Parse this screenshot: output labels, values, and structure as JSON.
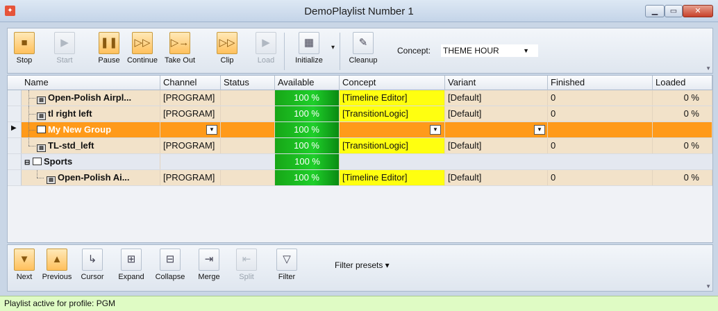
{
  "window": {
    "title": "DemoPlaylist Number 1",
    "app_icon": "app-logo-icon"
  },
  "top_toolbar": {
    "buttons": [
      {
        "label": "Stop",
        "icon": "stop-icon",
        "enabled": true
      },
      {
        "label": "Start",
        "icon": "play-icon",
        "enabled": false
      },
      {
        "label": "Pause",
        "icon": "pause-icon",
        "enabled": true
      },
      {
        "label": "Continue",
        "icon": "continue-icon",
        "enabled": true
      },
      {
        "label": "Take Out",
        "icon": "take-out-icon",
        "enabled": true
      },
      {
        "label": "Clip",
        "icon": "clip-icon",
        "enabled": true
      },
      {
        "label": "Load",
        "icon": "load-icon",
        "enabled": false
      },
      {
        "label": "Initialize",
        "icon": "initialize-icon",
        "enabled": true
      },
      {
        "label": "Cleanup",
        "icon": "cleanup-icon",
        "enabled": true
      }
    ],
    "concept_label": "Concept:",
    "concept_value": "THEME HOUR"
  },
  "grid": {
    "columns": [
      "Name",
      "Channel",
      "Status",
      "Available",
      "Concept",
      "Variant",
      "Finished",
      "Loaded"
    ],
    "rows": [
      {
        "name": "Open-Polish Airpl...",
        "channel": "[PROGRAM]",
        "status": "",
        "available": "100 %",
        "concept": "[Timeline Editor]",
        "variant": "[Default]",
        "finished": "0",
        "loaded": "0 %"
      },
      {
        "name": "tl right left",
        "channel": "[PROGRAM]",
        "status": "",
        "available": "100 %",
        "concept": "[TransitionLogic]",
        "variant": "[Default]",
        "finished": "0",
        "loaded": "0 %"
      },
      {
        "name": "My New Group",
        "channel": "",
        "status": "",
        "available": "100 %",
        "concept": "",
        "variant": "",
        "finished": "",
        "loaded": ""
      },
      {
        "name": "TL-std_left",
        "channel": "[PROGRAM]",
        "status": "",
        "available": "100 %",
        "concept": "[TransitionLogic]",
        "variant": "[Default]",
        "finished": "0",
        "loaded": "0 %"
      },
      {
        "name": "Sports",
        "channel": "",
        "status": "",
        "available": "100 %",
        "concept": "",
        "variant": "",
        "finished": "",
        "loaded": ""
      },
      {
        "name": "Open-Polish Ai...",
        "channel": "[PROGRAM]",
        "status": "",
        "available": "100 %",
        "concept": "[Timeline Editor]",
        "variant": "[Default]",
        "finished": "0",
        "loaded": "0 %"
      }
    ]
  },
  "bottom_toolbar": {
    "buttons": [
      {
        "label": "Next",
        "icon": "next-icon",
        "enabled": true
      },
      {
        "label": "Previous",
        "icon": "previous-icon",
        "enabled": true
      },
      {
        "label": "Cursor",
        "icon": "cursor-icon",
        "enabled": true
      },
      {
        "label": "Expand",
        "icon": "expand-icon",
        "enabled": true
      },
      {
        "label": "Collapse",
        "icon": "collapse-icon",
        "enabled": true
      },
      {
        "label": "Merge",
        "icon": "merge-icon",
        "enabled": true
      },
      {
        "label": "Split",
        "icon": "split-icon",
        "enabled": false
      },
      {
        "label": "Filter",
        "icon": "filter-icon",
        "enabled": true
      }
    ],
    "filter_presets": "Filter presets ▾"
  },
  "status_bar": {
    "text": "Playlist active for profile: PGM"
  },
  "colors": {
    "selected_row": "#ff9a1a",
    "program_row": "#f2e2c9",
    "available_green": "#1fcf2a",
    "concept_yellow": "#ffff10",
    "status_bar": "#dffbc4"
  }
}
